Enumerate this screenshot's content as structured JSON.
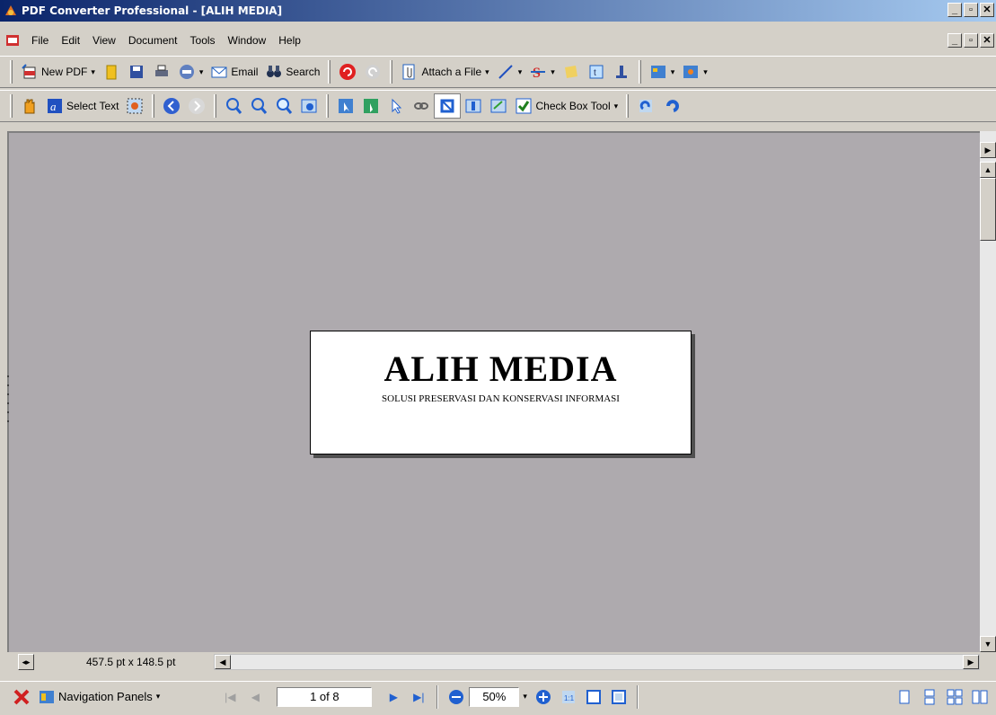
{
  "window": {
    "title": "PDF Converter Professional - [ALIH MEDIA]"
  },
  "menu": [
    "File",
    "Edit",
    "View",
    "Document",
    "Tools",
    "Window",
    "Help"
  ],
  "toolbar1": {
    "new_pdf": "New PDF",
    "email": "Email",
    "search": "Search",
    "attach": "Attach a File"
  },
  "toolbar2": {
    "select_text": "Select Text",
    "check_box_tool": "Check Box Tool"
  },
  "page": {
    "heading": "ALIH MEDIA",
    "subtitle": "SOLUSI PRESERVASI DAN KONSERVASI INFORMASI"
  },
  "status": {
    "dimensions": "457.5 pt x 148.5 pt"
  },
  "bottom": {
    "nav_panels": "Navigation Panels",
    "page_indicator": "1 of 8",
    "zoom": "50%"
  },
  "colors": {
    "accent_blue": "#0a246a",
    "canvas_gray": "#aeaaae"
  }
}
